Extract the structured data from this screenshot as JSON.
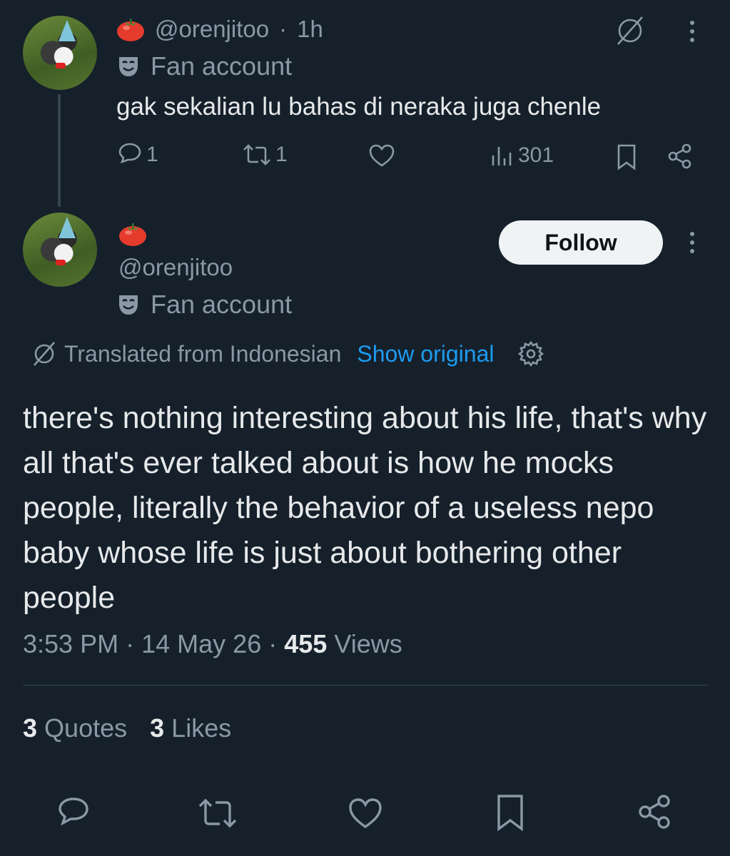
{
  "reply_tweet": {
    "handle": "@orenjitoo",
    "separator": "·",
    "time": "1h",
    "badge_label": "Fan account",
    "text": "gak sekalian lu bahas di neraka juga chenle",
    "replies": "1",
    "reposts": "1",
    "views": "301",
    "icons": [
      "tomato-icon",
      "mask-icon",
      "translate-icon",
      "more-icon",
      "reply-icon",
      "repost-icon",
      "like-icon",
      "views-icon",
      "bookmark-icon",
      "share-icon"
    ]
  },
  "main_tweet": {
    "handle": "@orenjitoo",
    "badge_label": "Fan account",
    "follow_label": "Follow",
    "translated_label": "Translated from Indonesian",
    "show_original_label": "Show original",
    "text": "there's nothing interesting about his life, that's why all that's ever talked about is how he mocks people, literally the behavior of a useless nepo baby whose life is just about bothering other people",
    "time": "3:53 PM",
    "sep1": "·",
    "date": "14 May 26",
    "sep2": "·",
    "views_count": "455",
    "views_label": "Views",
    "quotes_count": "3",
    "quotes_label": "Quotes",
    "likes_count": "3",
    "likes_label": "Likes"
  },
  "colors": {
    "background": "#15202b",
    "text": "#e7e9ea",
    "muted": "#8b98a5",
    "link": "#1d9bf0",
    "follow_bg": "#eff3f4"
  }
}
